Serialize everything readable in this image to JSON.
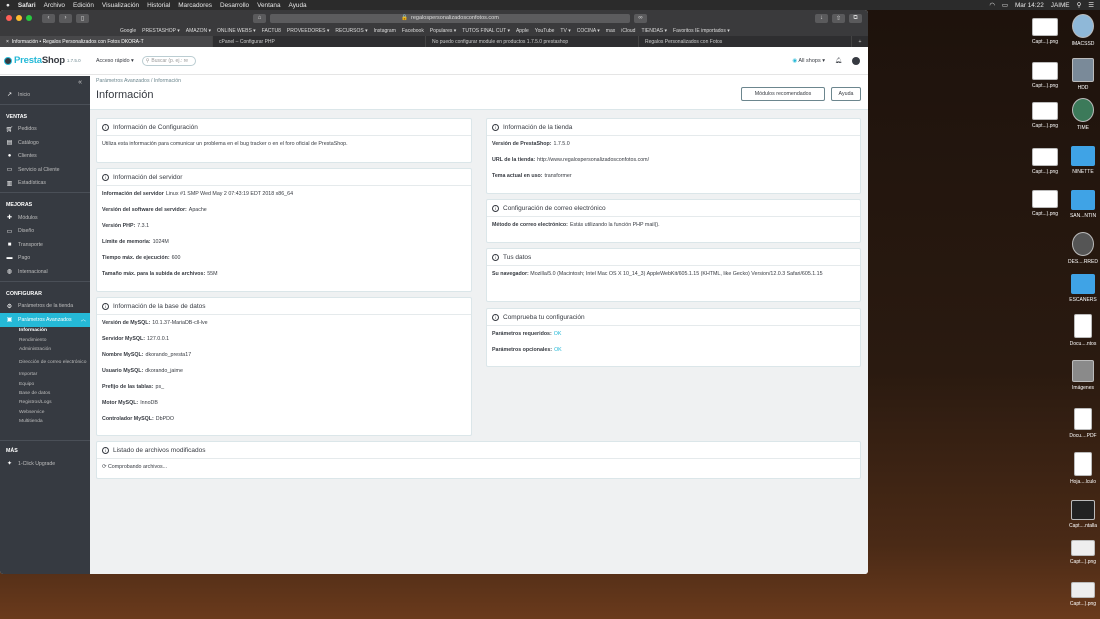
{
  "menubar": {
    "apple": "",
    "app": "Safari",
    "items": [
      "Archivo",
      "Edición",
      "Visualización",
      "Historial",
      "Marcadores",
      "Desarrollo",
      "Ventana",
      "Ayuda"
    ],
    "clock": "Mar 14:22",
    "user": "JAIME"
  },
  "browser": {
    "url": "regalospersonalizadosconfotos.com",
    "bookmarks": [
      "Google",
      "PRESTASHOP ▾",
      "AMAZON ▾",
      "ONLINE WEBS ▾",
      "FACTU8",
      "PROVEEDORES ▾",
      "RECURSOS ▾",
      "Instagram",
      "Facebook",
      "Populares ▾",
      "TUTOS FINAL CUT ▾",
      "Apple",
      "YouTube",
      "TV ▾",
      "COCINA ▾",
      "max",
      "iCloud",
      "TIENDAS ▾",
      "Favoritos IE importados ▾"
    ],
    "tabs": [
      "Información • Regalos Personalizados con Fotos DKORA-T",
      "cPanel – Configurar PHP",
      "No puedo configurar module en productos 1.7.5.0 prestashop",
      "Regalos Personalizados con Fotos"
    ]
  },
  "header": {
    "logo_a": "Presta",
    "logo_b": "Shop",
    "version": "1.7.5.0",
    "quick_access": "Acceso rápido ▾",
    "search_placeholder": "Buscar (p. ej.: re",
    "all_shops": "All shops ▾"
  },
  "sidebar": {
    "inicio": "Inicio",
    "ventas": "VENTAS",
    "ventas_items": [
      "Pedidos",
      "Catálogo",
      "Clientes",
      "Servicio al Cliente",
      "Estadísticas"
    ],
    "mejoras": "MEJORAS",
    "mejoras_items": [
      "Módulos",
      "Diseño",
      "Transporte",
      "Pago",
      "Internacional"
    ],
    "configurar": "CONFIGURAR",
    "config_items": [
      "Parámetros de la tienda",
      "Parámetros Avanzados"
    ],
    "subitems": [
      "Información",
      "Rendimiento",
      "Administración",
      "Dirección de correo electrónico",
      "Importar",
      "Equipo",
      "Base de datos",
      "Registros/Logs",
      "Webservice",
      "Multitienda"
    ],
    "mas": "MÁS",
    "mas_items": [
      "1-Click Upgrade"
    ]
  },
  "page": {
    "breadcrumb": "Parámetros Avanzados  /  Información",
    "title": "Información",
    "btn_modules": "Módulos recomendados",
    "btn_help": "Ayuda"
  },
  "config_panel": {
    "title": "Información de Configuración",
    "text": "Utiliza esta información para comunicar un problema en el bug tracker o en el foro oficial de PrestaShop."
  },
  "server_panel": {
    "title": "Información del servidor",
    "rows": [
      {
        "k": "Información del servidor",
        "v": "Linux #1 SMP Wed May 2 07:43:19 EDT 2018 x86_64"
      },
      {
        "k": "Versión del software del servidor:",
        "v": "Apache"
      },
      {
        "k": "Versión PHP:",
        "v": "7.3.1"
      },
      {
        "k": "Límite de memoria:",
        "v": "1024M"
      },
      {
        "k": "Tiempo máx. de ejecución:",
        "v": "600"
      },
      {
        "k": "Tamaño máx. para la subida de archivos:",
        "v": "55M"
      }
    ]
  },
  "db_panel": {
    "title": "Información de la base de datos",
    "rows": [
      {
        "k": "Versión de MySQL:",
        "v": "10.1.37-MariaDB-cll-lve"
      },
      {
        "k": "Servidor MySQL:",
        "v": "127.0.0.1"
      },
      {
        "k": "Nombre MySQL:",
        "v": "dkorando_presta17"
      },
      {
        "k": "Usuario MySQL:",
        "v": "dkorando_jaime"
      },
      {
        "k": "Prefijo de las tablas:",
        "v": "ps_"
      },
      {
        "k": "Motor MySQL:",
        "v": "InnoDB"
      },
      {
        "k": "Controlador MySQL:",
        "v": "DbPDO"
      }
    ]
  },
  "store_panel": {
    "title": "Información de la tienda",
    "rows": [
      {
        "k": "Versión de PrestaShop:",
        "v": "1.7.5.0"
      },
      {
        "k": "URL de la tienda:",
        "v": "http://www.regalospersonalizadosconfotos.com/"
      },
      {
        "k": "Tema actual en uso:",
        "v": "transformer"
      }
    ]
  },
  "mail_panel": {
    "title": "Configuración de correo electrónico",
    "k": "Método de correo electrónico:",
    "v": "Estás utilizando la función PHP mail()."
  },
  "you_panel": {
    "title": "Tus datos",
    "k": "Su navegador:",
    "v": "Mozilla/5.0 (Macintosh; Intel Mac OS X 10_14_3) AppleWebKit/605.1.15 (KHTML, like Gecko) Version/12.0.3 Safari/605.1.15"
  },
  "check_panel": {
    "title": "Comprueba tu configuración",
    "rows": [
      {
        "k": "Parámetros requeridos:",
        "v": "OK"
      },
      {
        "k": "Parámetros opcionales:",
        "v": "OK"
      }
    ]
  },
  "files_panel": {
    "title": "Listado de archivos modificados",
    "text": "Comprobando archivos..."
  },
  "desktop": [
    "Capt...).png",
    "IMACSSD",
    "Capt...).png",
    "HDD",
    "Capt...).png",
    "TIME",
    "Capt...).png",
    "NINETTE",
    "Capt...).png",
    "SAN...NTIN",
    "DES....RRED",
    "ESCANERS",
    "Docu....ntos",
    "Imágenes",
    "Docu....PDF",
    "Hoja....lculo",
    "Capt....ntalla",
    "Capt...).png",
    "Capt...).png"
  ],
  "colors": {
    "accent": "#25b9d7",
    "sidebar": "#363a41"
  }
}
